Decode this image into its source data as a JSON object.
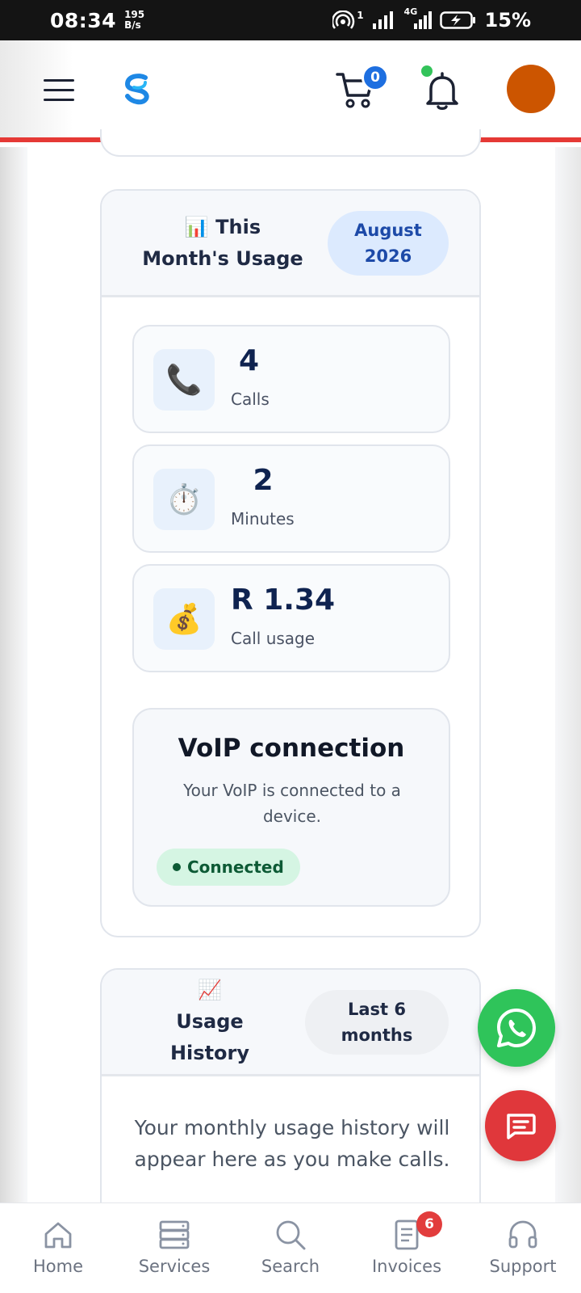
{
  "status_bar": {
    "time": "08:34",
    "speed_value": "195",
    "speed_unit": "B/s",
    "hotspot_count": "1",
    "network_type": "4G",
    "battery": "15%"
  },
  "header": {
    "cart_count": "0",
    "avatar_color": "#cc5500",
    "accent_color": "#e53935"
  },
  "usage": {
    "icon": "📊",
    "title": "This Month's Usage",
    "period": "August 2026",
    "stats": [
      {
        "icon": "📞",
        "value": "4",
        "label": "Calls"
      },
      {
        "icon": "⏱️",
        "value": "2",
        "label": "Minutes"
      },
      {
        "icon": "💰",
        "value": "R 1.34",
        "label": "Call usage"
      }
    ],
    "voip": {
      "title": "VoIP connection",
      "description": "Your VoIP is connected to a device.",
      "status": "Connected",
      "status_color": "#d5f5e3"
    }
  },
  "history": {
    "icon": "📈",
    "title": "Usage History",
    "range": "Last 6 months",
    "empty_message": "Your monthly usage history will appear here as you make calls."
  },
  "fabs": {
    "whatsapp_icon": "whatsapp-icon",
    "chat_icon": "chat-icon"
  },
  "bottom_nav": [
    {
      "label": "Home",
      "icon": "home-icon"
    },
    {
      "label": "Services",
      "icon": "server-icon"
    },
    {
      "label": "Search",
      "icon": "search-icon"
    },
    {
      "label": "Invoices",
      "icon": "invoice-icon",
      "badge": "6"
    },
    {
      "label": "Support",
      "icon": "headset-icon"
    }
  ]
}
